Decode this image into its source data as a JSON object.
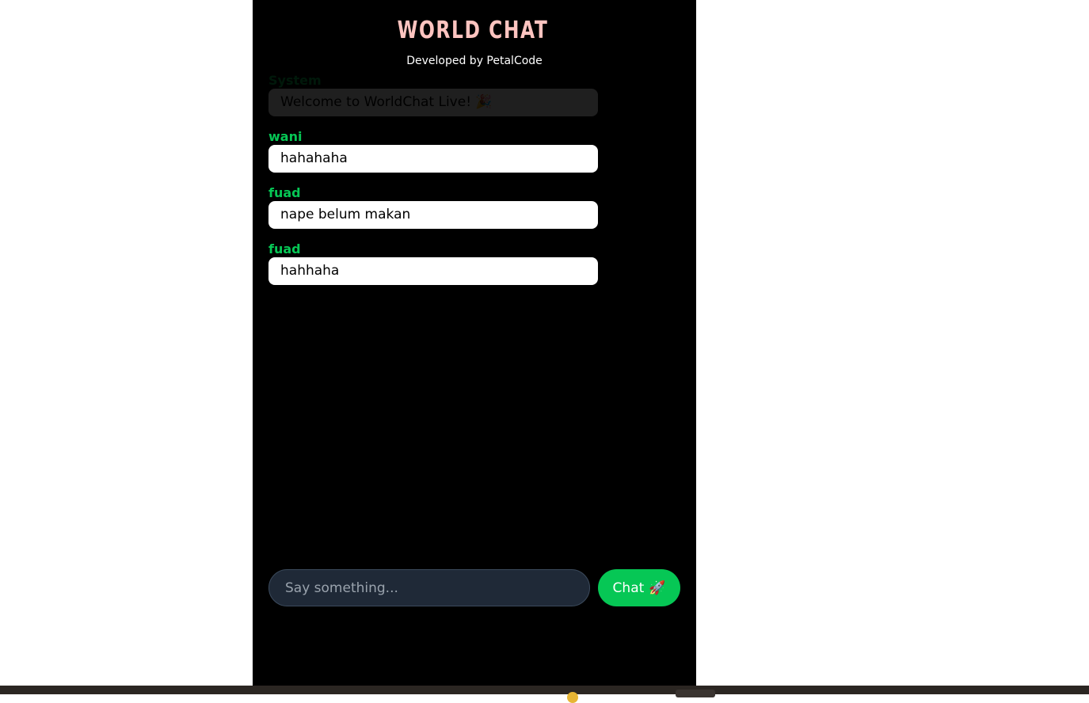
{
  "header": {
    "title": "WORLD CHAT",
    "subtitle": "Developed by PetalCode"
  },
  "messages": [
    {
      "sender": "System",
      "text": "Welcome to WorldChat Live! 🎉",
      "kind": "system"
    },
    {
      "sender": "wani",
      "text": "hahahaha",
      "kind": "user"
    },
    {
      "sender": "fuad",
      "text": "nape belum makan",
      "kind": "user"
    },
    {
      "sender": "fuad",
      "text": "hahhaha",
      "kind": "user"
    }
  ],
  "composer": {
    "placeholder": "Say something...",
    "value": "",
    "send_label": "Chat",
    "send_icon": "rocket-icon",
    "send_emoji": "🚀"
  },
  "colors": {
    "accent": "#06c755",
    "title": "#ffc4c0",
    "background": "#000000",
    "input_bg": "#1f2937"
  }
}
